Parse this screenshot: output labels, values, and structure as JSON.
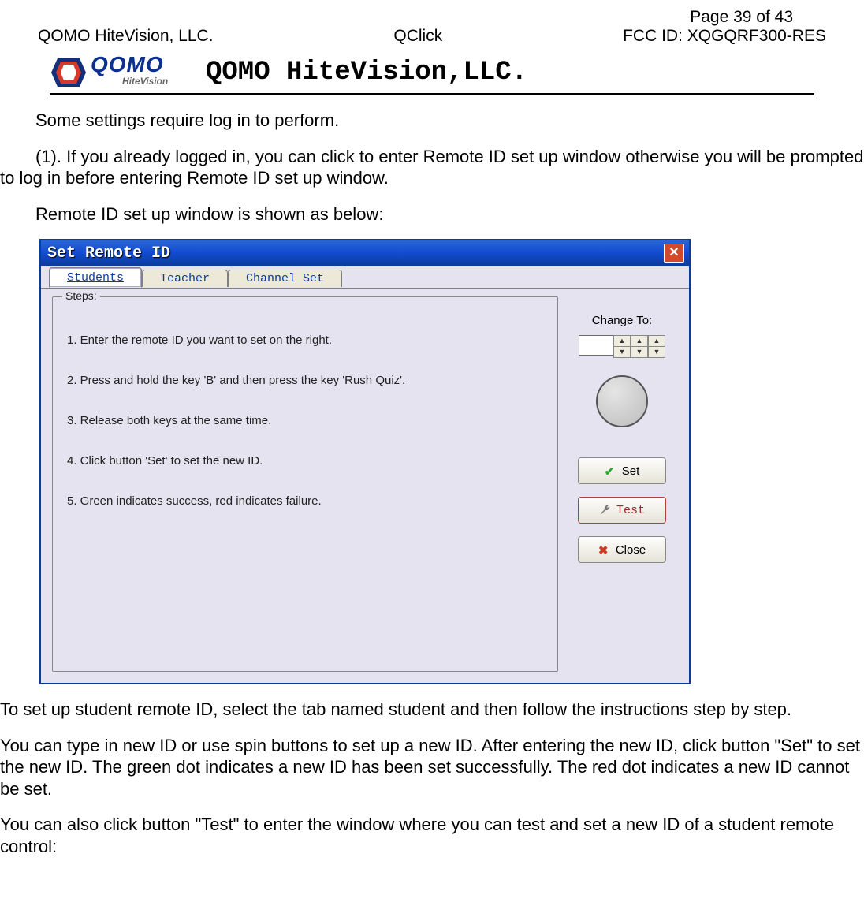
{
  "header": {
    "page_line": "Page 39 of 43",
    "left": "QOMO HiteVision, LLC.",
    "center": "QClick",
    "right": "FCC ID: XQGQRF300-RES",
    "logo_main": "QOMO",
    "logo_sub": "HiteVision",
    "letterhead_title": "QOMO HiteVision,LLC."
  },
  "paras": {
    "p1": "Some settings require log in to perform.",
    "p2": "(1). If you already logged in, you can click to enter Remote ID set up window otherwise you will be prompted to log in before entering Remote ID set up window.",
    "p3": "Remote ID set up window is shown as below:",
    "p4": "To set up student remote ID, select the tab named student and then follow the instructions step by step.",
    "p5": "You can type in new ID or use spin buttons to set up a new ID. After entering the new ID, click button \"Set\" to set the new ID. The green dot indicates a new ID has been set successfully. The red dot indicates a new ID cannot be set.",
    "p6": "You can also click button \"Test\" to enter the window where you can test and set a new ID of a student remote control:"
  },
  "dialog": {
    "title": "Set Remote ID",
    "tabs": {
      "t0": "Students",
      "t1": "Teacher",
      "t2": "Channel Set"
    },
    "steps_legend": "Steps:",
    "steps": {
      "s1": "1. Enter the remote ID you want to set on the right.",
      "s2": "2. Press and hold the key 'B' and then press the key 'Rush Quiz'.",
      "s3": "3. Release both keys at the same time.",
      "s4": "4. Click button 'Set' to set the new ID.",
      "s5": "5. Green indicates success, red indicates failure."
    },
    "side": {
      "change_label": "Change To:",
      "input_value": "",
      "btn_set": "Set",
      "btn_test": "Test",
      "btn_close": "Close"
    }
  }
}
